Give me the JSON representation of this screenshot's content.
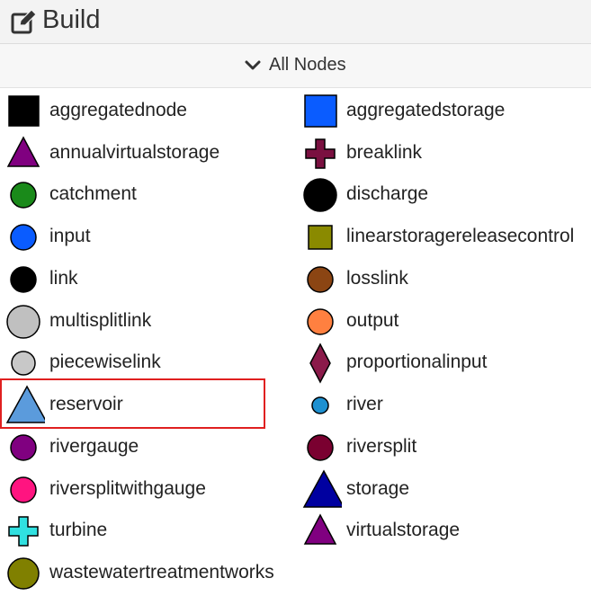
{
  "header": {
    "title": "Build",
    "icon": "edit-icon"
  },
  "section": {
    "label": "All Nodes",
    "icon": "chevron-down-icon"
  },
  "nodes": [
    {
      "label": "aggregatednode",
      "shape": "square",
      "color": "#000000"
    },
    {
      "label": "aggregatedstorage",
      "shape": "square",
      "color": "#0a5cff"
    },
    {
      "label": "annualvirtualstorage",
      "shape": "triangle",
      "color": "#800080"
    },
    {
      "label": "breaklink",
      "shape": "cross",
      "color": "#7a1040"
    },
    {
      "label": "catchment",
      "shape": "circle",
      "color": "#1a8a1a"
    },
    {
      "label": "discharge",
      "shape": "circle",
      "color": "#000000"
    },
    {
      "label": "input",
      "shape": "circle",
      "color": "#0a5cff"
    },
    {
      "label": "linearstoragereleasecontrol",
      "shape": "square",
      "color": "#8a8a00"
    },
    {
      "label": "link",
      "shape": "circle",
      "color": "#000000"
    },
    {
      "label": "losslink",
      "shape": "circle",
      "color": "#8b4513"
    },
    {
      "label": "multisplitlink",
      "shape": "circle",
      "color": "#c0c0c0"
    },
    {
      "label": "output",
      "shape": "circle",
      "color": "#ff8040"
    },
    {
      "label": "piecewiselink",
      "shape": "circle",
      "color": "#c0c0c0"
    },
    {
      "label": "proportionalinput",
      "shape": "diamond",
      "color": "#8b1a4a"
    },
    {
      "label": "reservoir",
      "shape": "triangle",
      "color": "#5b9bdc"
    },
    {
      "label": "river",
      "shape": "circle",
      "color": "#1e90d0"
    },
    {
      "label": "rivergauge",
      "shape": "circle",
      "color": "#800080"
    },
    {
      "label": "riversplit",
      "shape": "circle",
      "color": "#7a0030"
    },
    {
      "label": "riversplitwithgauge",
      "shape": "circle",
      "color": "#ff1480"
    },
    {
      "label": "storage",
      "shape": "triangle",
      "color": "#0000a0"
    },
    {
      "label": "turbine",
      "shape": "cross",
      "color": "#30e0e0"
    },
    {
      "label": "virtualstorage",
      "shape": "triangle",
      "color": "#800080"
    },
    {
      "label": "wastewatertreatmentworks",
      "shape": "circle",
      "color": "#808000"
    }
  ]
}
